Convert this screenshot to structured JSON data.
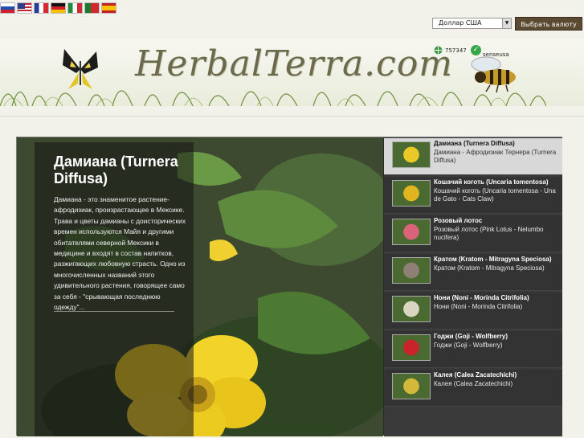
{
  "languages": [
    {
      "icon": "flag-ru-icon"
    },
    {
      "icon": "flag-us-icon"
    },
    {
      "icon": "flag-fr-icon"
    },
    {
      "icon": "flag-de-icon"
    },
    {
      "icon": "flag-it-icon"
    },
    {
      "icon": "flag-pt-icon"
    },
    {
      "icon": "flag-es-icon"
    }
  ],
  "currency": {
    "selected": "Доллар США",
    "button_label": "Выбрать валюту"
  },
  "header": {
    "logo_text": "HerbalTerra.com",
    "counter_value": "757347",
    "user_label": "senseusa"
  },
  "slide": {
    "title": "Дамиана (Turnera Diffusa)",
    "description": "Дамиана - это знаменитое растение-афродизиак, произрастающее в Мексике. Трава и цветы дамианы с доисторических времен используются Майя и другими обитателями северной Мексики в медицине и входят в состав напитков, разжигающих любовную страсть. Одно из многочисленных названий этого удивительного растения, говорящее само за себя - \"срывающая последнюю одежду\"..."
  },
  "thumbnails": [
    {
      "title": "Дамиана (Turnera Diffusa)",
      "desc": "Дамиана - Афродизиак Тернера (Turnera Diffusa)",
      "color": "#e8c928",
      "active": true
    },
    {
      "title": "Кошачий коготь (Uncaria tomentosa)",
      "desc": "Кошачий коготь (Uncaria tomentosa - Una de Gato - Cats Claw)",
      "color": "#e0b520",
      "active": false
    },
    {
      "title": "Розовый лотос",
      "desc": "Розовый лотос (Pink Lotus - Nelumbo nucifera)",
      "color": "#d9647a",
      "active": false
    },
    {
      "title": "Кратом (Kratom - Mitragyna Speciosa)",
      "desc": "Кратом (Kratom - Mitragyna Speciosa)",
      "color": "#8f7f74",
      "active": false
    },
    {
      "title": "Нони (Noni - Morinda Citrifolia)",
      "desc": "Нони (Noni - Morinda Citrifolia)",
      "color": "#d8d6c0",
      "active": false
    },
    {
      "title": "Годжи (Goji - Wolfberry)",
      "desc": "Годжи (Goji - Wolfberry)",
      "color": "#c9232c",
      "active": false
    },
    {
      "title": "Калея (Calea Zacatechichi)",
      "desc": "Калея (Calea Zacatechichi)",
      "color": "#d2b93a",
      "active": false
    }
  ]
}
